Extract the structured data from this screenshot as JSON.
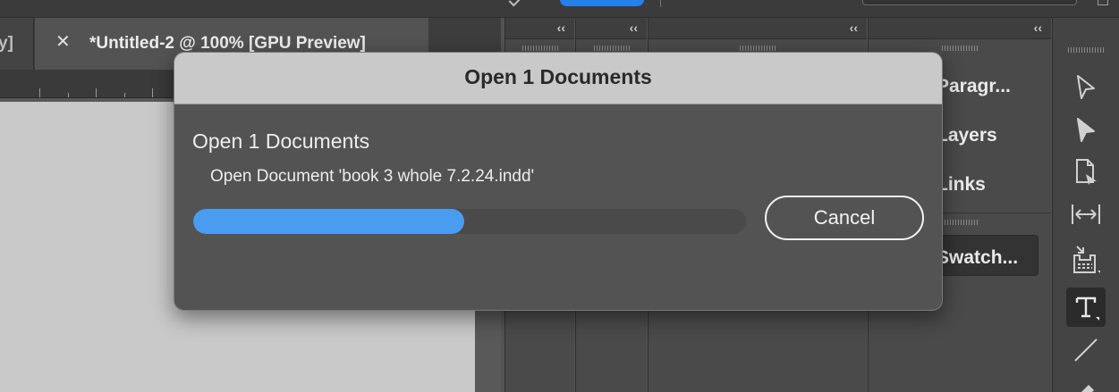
{
  "tabs": {
    "previous_tab_fragment": "y]",
    "close_glyph": "✕",
    "active_title": "*Untitled-2 @ 100% [GPU Preview]"
  },
  "panels": {
    "collapse_glyph": "‹‹",
    "paragraph_label": "Paragr...",
    "layers_label": "Layers",
    "links_label": "Links",
    "swatches_label": "Swatch..."
  },
  "tools": [
    {
      "icon": "selection-tool-icon"
    },
    {
      "icon": "direct-selection-tool-icon"
    },
    {
      "icon": "page-tool-icon"
    },
    {
      "icon": "gap-tool-icon"
    },
    {
      "icon": "content-collector-icon"
    },
    {
      "icon": "type-tool-icon",
      "active": true
    },
    {
      "icon": "line-tool-icon"
    },
    {
      "icon": "pen-tool-icon"
    }
  ],
  "dialog": {
    "title": "Open 1 Documents",
    "heading": "Open 1 Documents",
    "status": "Open Document 'book 3 whole 7.2.24.indd'",
    "progress": 0.49,
    "cancel_label": "Cancel",
    "accent_color": "#4a9cf0"
  }
}
